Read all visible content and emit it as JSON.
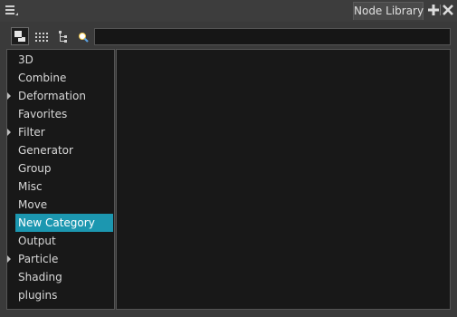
{
  "window": {
    "tab_label": "Node Library",
    "menu_icon": "hamburger-menu-icon",
    "add_icon": "plus-icon",
    "close_icon": "close-icon"
  },
  "toolbar": {
    "tools": [
      {
        "icon": "single-view-icon",
        "active": true
      },
      {
        "icon": "list-view-icon",
        "active": false
      },
      {
        "icon": "tree-view-icon",
        "active": false
      }
    ],
    "search": {
      "icon": "search-icon",
      "value": "",
      "placeholder": ""
    }
  },
  "categories": {
    "items": [
      {
        "label": "3D",
        "expandable": false,
        "selected": false
      },
      {
        "label": "Combine",
        "expandable": false,
        "selected": false
      },
      {
        "label": "Deformation",
        "expandable": true,
        "selected": false
      },
      {
        "label": "Favorites",
        "expandable": false,
        "selected": false
      },
      {
        "label": "Filter",
        "expandable": true,
        "selected": false
      },
      {
        "label": "Generator",
        "expandable": false,
        "selected": false
      },
      {
        "label": "Group",
        "expandable": false,
        "selected": false
      },
      {
        "label": "Misc",
        "expandable": false,
        "selected": false
      },
      {
        "label": "Move",
        "expandable": false,
        "selected": false
      },
      {
        "label": "New Category",
        "expandable": false,
        "selected": true
      },
      {
        "label": "Output",
        "expandable": false,
        "selected": false
      },
      {
        "label": "Particle",
        "expandable": true,
        "selected": false
      },
      {
        "label": "Shading",
        "expandable": false,
        "selected": false
      },
      {
        "label": "plugins",
        "expandable": false,
        "selected": false
      }
    ]
  },
  "colors": {
    "selection": "#1c97b0",
    "panel_bg": "#181818",
    "window_bg": "#3a3a3a"
  }
}
